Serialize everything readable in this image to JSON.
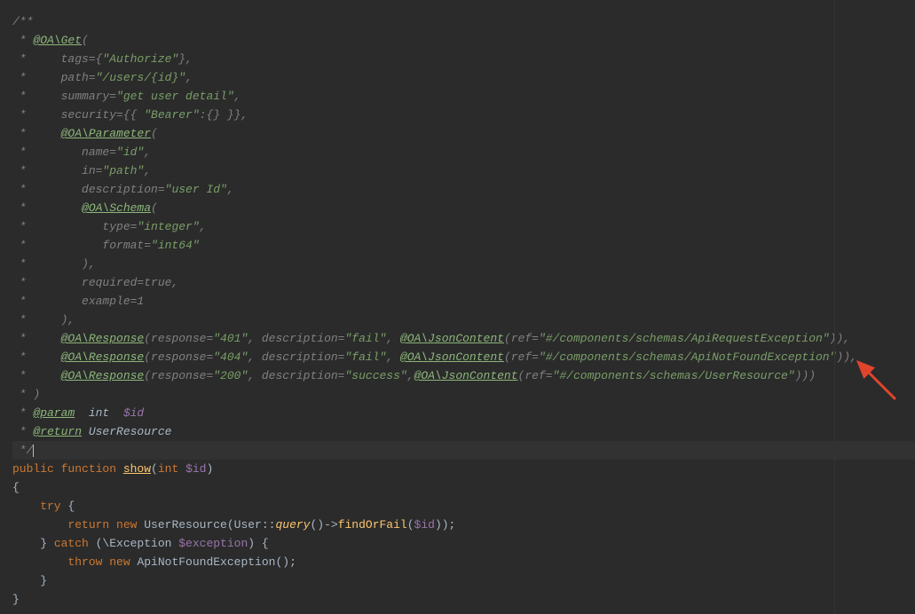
{
  "lines": {
    "l1": "/**",
    "l2p": " * ",
    "l2a": "@OA\\Get",
    "l2s": "(",
    "l3p": " *     tags={",
    "l3s": "\"Authorize\"",
    "l3e": "},",
    "l4p": " *     path=",
    "l4s": "\"/users/{id}\"",
    "l4e": ",",
    "l5p": " *     summary=",
    "l5s": "\"get user detail\"",
    "l5e": ",",
    "l6p": " *     security={{ ",
    "l6s": "\"Bearer\"",
    "l6e": ":{} }},",
    "l7p": " *     ",
    "l7a": "@OA\\Parameter",
    "l7s": "(",
    "l8p": " *        name=",
    "l8s": "\"id\"",
    "l8e": ",",
    "l9p": " *        in=",
    "l9s": "\"path\"",
    "l9e": ",",
    "l10p": " *        description=",
    "l10s": "\"user Id\"",
    "l10e": ",",
    "l11p": " *        ",
    "l11a": "@OA\\Schema",
    "l11s": "(",
    "l12p": " *           type=",
    "l12s": "\"integer\"",
    "l12e": ",",
    "l13p": " *           format=",
    "l13s": "\"int64\"",
    "l14": " *        ),",
    "l15": " *        required=true,",
    "l16": " *        example=1",
    "l17": " *     ),",
    "l18p": " *     ",
    "l18a": "@OA\\Response",
    "l18b": "(response=",
    "l18s1": "\"401\"",
    "l18c": ", description=",
    "l18s2": "\"fail\"",
    "l18d": ", ",
    "l18a2": "@OA\\JsonContent",
    "l18e": "(ref=",
    "l18s3": "\"#/components/schemas/ApiRequestException\"",
    "l18f": ")),",
    "l19p": " *     ",
    "l19a": "@OA\\Response",
    "l19b": "(response=",
    "l19s1": "\"404\"",
    "l19c": ", description=",
    "l19s2": "\"fail\"",
    "l19d": ", ",
    "l19a2": "@OA\\JsonContent",
    "l19e": "(ref=",
    "l19s3": "\"#/components/schemas/ApiNotFoundException\"",
    "l19f": ")),",
    "l20p": " *     ",
    "l20a": "@OA\\Response",
    "l20b": "(response=",
    "l20s1": "\"200\"",
    "l20c": ", description=",
    "l20s2": "\"success\"",
    "l20d": ",",
    "l20a2": "@OA\\JsonContent",
    "l20e": "(ref=",
    "l20s3": "\"#/components/schemas/UserResource\"",
    "l20f": ")))",
    "l21": " * )",
    "l22p": " * ",
    "l22a": "@param",
    "l22t": "  int  ",
    "l22v": "$id",
    "l23p": " * ",
    "l23a": "@return",
    "l23t": " UserResource",
    "l24": " */",
    "c1a": "public",
    "c1b": " function ",
    "c1c": "show",
    "c1d": "(",
    "c1e": "int ",
    "c1f": "$id",
    "c1g": ")",
    "c2": "{",
    "c3a": "    try ",
    "c3b": "{",
    "c4a": "        return new ",
    "c4b": "UserResource(User",
    "c4c": "::",
    "c4d": "query",
    "c4e": "()->",
    "c4f": "findOrFail",
    "c4g": "(",
    "c4h": "$id",
    "c4i": "))",
    "c4j": ";",
    "c5a": "    } ",
    "c5b": "catch ",
    "c5c": "(\\Exception ",
    "c5d": "$exception",
    "c5e": ") {",
    "c6a": "        throw new ",
    "c6b": "ApiNotFoundException()",
    "c6c": ";",
    "c7": "    }",
    "c8": "}"
  }
}
